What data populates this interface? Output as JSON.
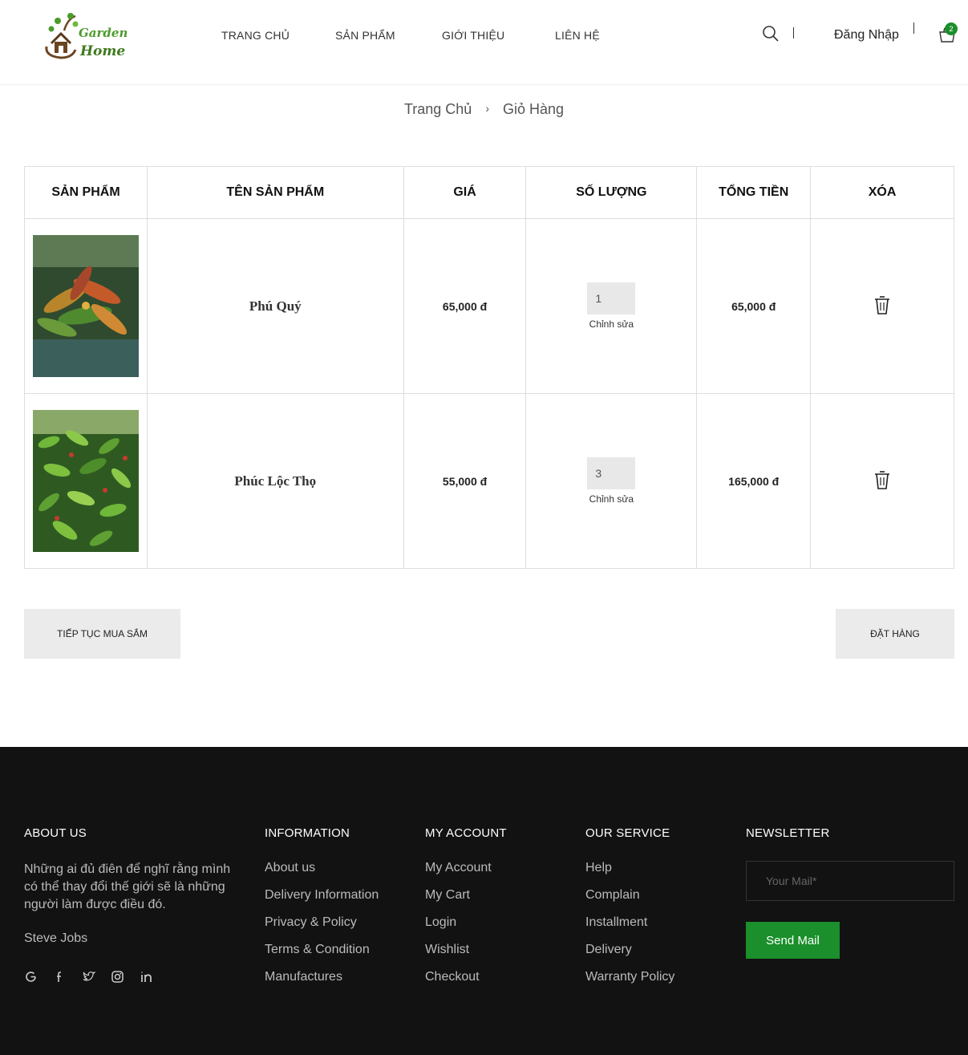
{
  "header": {
    "logo_text_1": "Garden",
    "logo_text_2": "Home",
    "nav": [
      "TRANG CHỦ",
      "SẢN PHẨM",
      "GIỚI THIỆU",
      "LIÊN HỆ"
    ],
    "login": "Đăng Nhập",
    "cart_count": "2"
  },
  "breadcrumb": {
    "home": "Trang Chủ",
    "current": "Giỏ Hàng"
  },
  "cart": {
    "headers": [
      "SẢN PHẨM",
      "TÊN SẢN PHẨM",
      "GIÁ",
      "SỐ LƯỢNG",
      "TỔNG TIỀN",
      "XÓA"
    ],
    "rows": [
      {
        "name": "Phú Quý",
        "price": "65,000 đ",
        "qty": "1",
        "edit": "Chỉnh sửa",
        "total": "65,000 đ"
      },
      {
        "name": "Phúc Lộc Thọ",
        "price": "55,000 đ",
        "qty": "3",
        "edit": "Chỉnh sửa",
        "total": "165,000 đ"
      }
    ],
    "continue_label": "TIẾP TỤC MUA SẮM",
    "order_label": "ĐẶT HÀNG"
  },
  "footer": {
    "about": {
      "title": "ABOUT US",
      "text": "Những ai đủ điên để nghĩ rằng mình có thể thay đổi thế giới sẽ là những người làm được điều đó.",
      "author": "Steve Jobs",
      "socials": [
        "google-icon",
        "facebook-icon",
        "twitter-icon",
        "instagram-icon",
        "linkedin-icon"
      ]
    },
    "information": {
      "title": "INFORMATION",
      "items": [
        "About us",
        "Delivery Information",
        "Privacy & Policy",
        "Terms & Condition",
        "Manufactures"
      ]
    },
    "account": {
      "title": "MY ACCOUNT",
      "items": [
        "My Account",
        "My Cart",
        "Login",
        "Wishlist",
        "Checkout"
      ]
    },
    "service": {
      "title": "OUR SERVICE",
      "items": [
        "Help",
        "Complain",
        "Installment",
        "Delivery",
        "Warranty Policy"
      ]
    },
    "newsletter": {
      "title": "NEWSLETTER",
      "placeholder": "Your Mail*",
      "button": "Send Mail"
    }
  },
  "colors": {
    "brand_green": "#1a8f2b",
    "footer_bg": "#121212"
  }
}
